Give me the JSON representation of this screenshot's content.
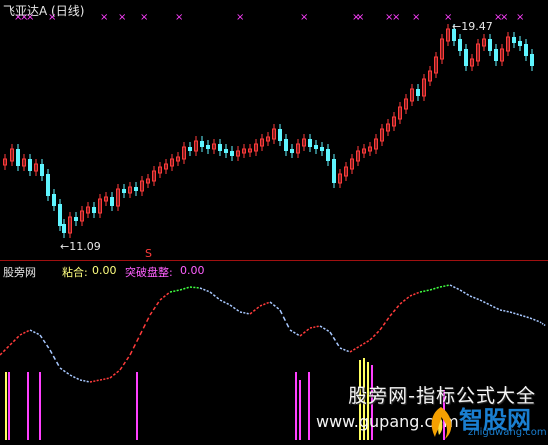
{
  "window": {
    "title": "飞亚达A (日线)"
  },
  "main_chart": {
    "high_label": "19.47",
    "low_label": "11.09",
    "signal_mark": "S",
    "cross_marks": "×"
  },
  "indicator_panel": {
    "name": "股旁网",
    "sticky_label": "粘合:",
    "sticky_value": "0.00",
    "breakout_label": "突破盘整:",
    "breakout_value": "0.00"
  },
  "watermark": {
    "site_cn": "股旁网-指标公式大全",
    "site_url": "www.gupang.com",
    "brand_cn": "智股网",
    "brand_url": "zhiguwang.com"
  },
  "colors": {
    "up": "#ff3b3b",
    "down": "#5ff5ff",
    "cross": "#ff40ff",
    "indicator_red": "#ff3b3b",
    "indicator_blue": "#a8c8ff",
    "indicator_green": "#40ff40",
    "bars_magenta": "#ff40ff",
    "bars_yellow": "#ffff60",
    "divider": "#a01010"
  }
}
